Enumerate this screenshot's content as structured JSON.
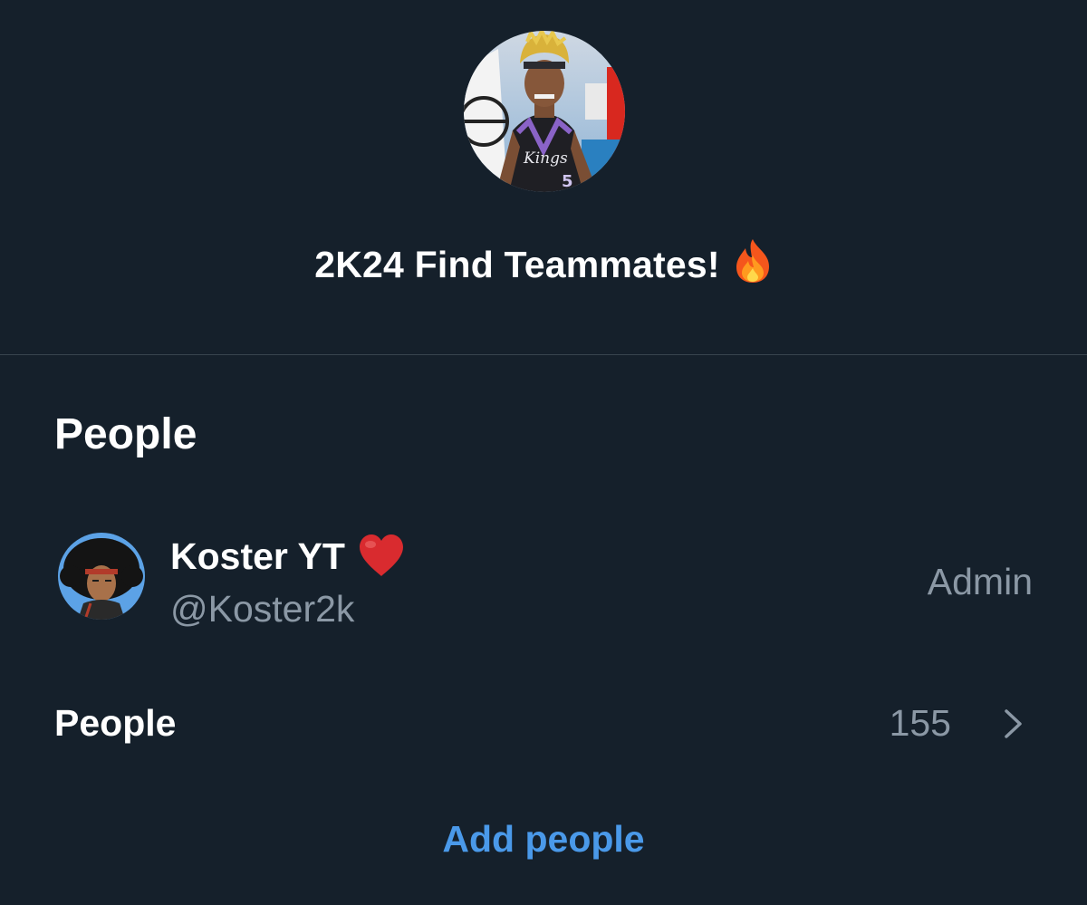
{
  "group": {
    "title": "2K24 Find Teammates!",
    "title_emoji": "fire-emoji",
    "avatar": "group-avatar-basketball-player-image"
  },
  "people_section": {
    "heading": "People",
    "members": [
      {
        "name": "Koster YT",
        "name_emoji": "red-heart-emoji",
        "handle": "@Koster2k",
        "role": "Admin"
      }
    ],
    "people_row_label": "People",
    "people_count": "155"
  },
  "actions": {
    "add_people_label": "Add people"
  },
  "colors": {
    "background": "#15202b",
    "divider": "#38444d",
    "secondary_text": "#8b98a5",
    "accent": "#4a99e9"
  }
}
